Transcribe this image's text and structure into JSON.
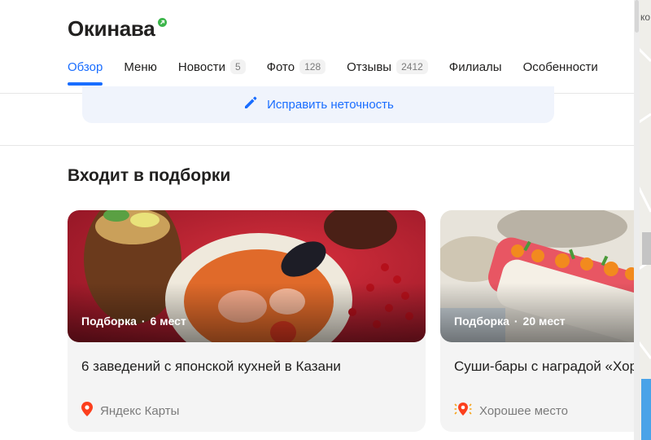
{
  "header": {
    "title": "Окинава"
  },
  "tabs": [
    {
      "label": "Обзор",
      "active": true
    },
    {
      "label": "Меню"
    },
    {
      "label": "Новости",
      "count": "5"
    },
    {
      "label": "Фото",
      "count": "128"
    },
    {
      "label": "Отзывы",
      "count": "2412"
    },
    {
      "label": "Филиалы"
    },
    {
      "label": "Особенности"
    }
  ],
  "fix": {
    "label": "Исправить неточность",
    "icon": "pencil-icon"
  },
  "collections": {
    "title": "Входит в подборки",
    "cards": [
      {
        "meta_type": "Подборка",
        "meta_count": "6 мест",
        "name": "6 заведений с японской кухней в Казани",
        "source": "Яндекс Карты",
        "source_icon": "map-pin-icon"
      },
      {
        "meta_type": "Подборка",
        "meta_count": "20 мест",
        "name": "Суши-бары с наградой «Хорошее место» в Казани",
        "source": "Хорошее место",
        "source_icon": "good-place-icon"
      }
    ]
  },
  "map": {
    "label": "ко"
  },
  "colors": {
    "accent": "#196dff",
    "verified": "#3bb54a"
  }
}
